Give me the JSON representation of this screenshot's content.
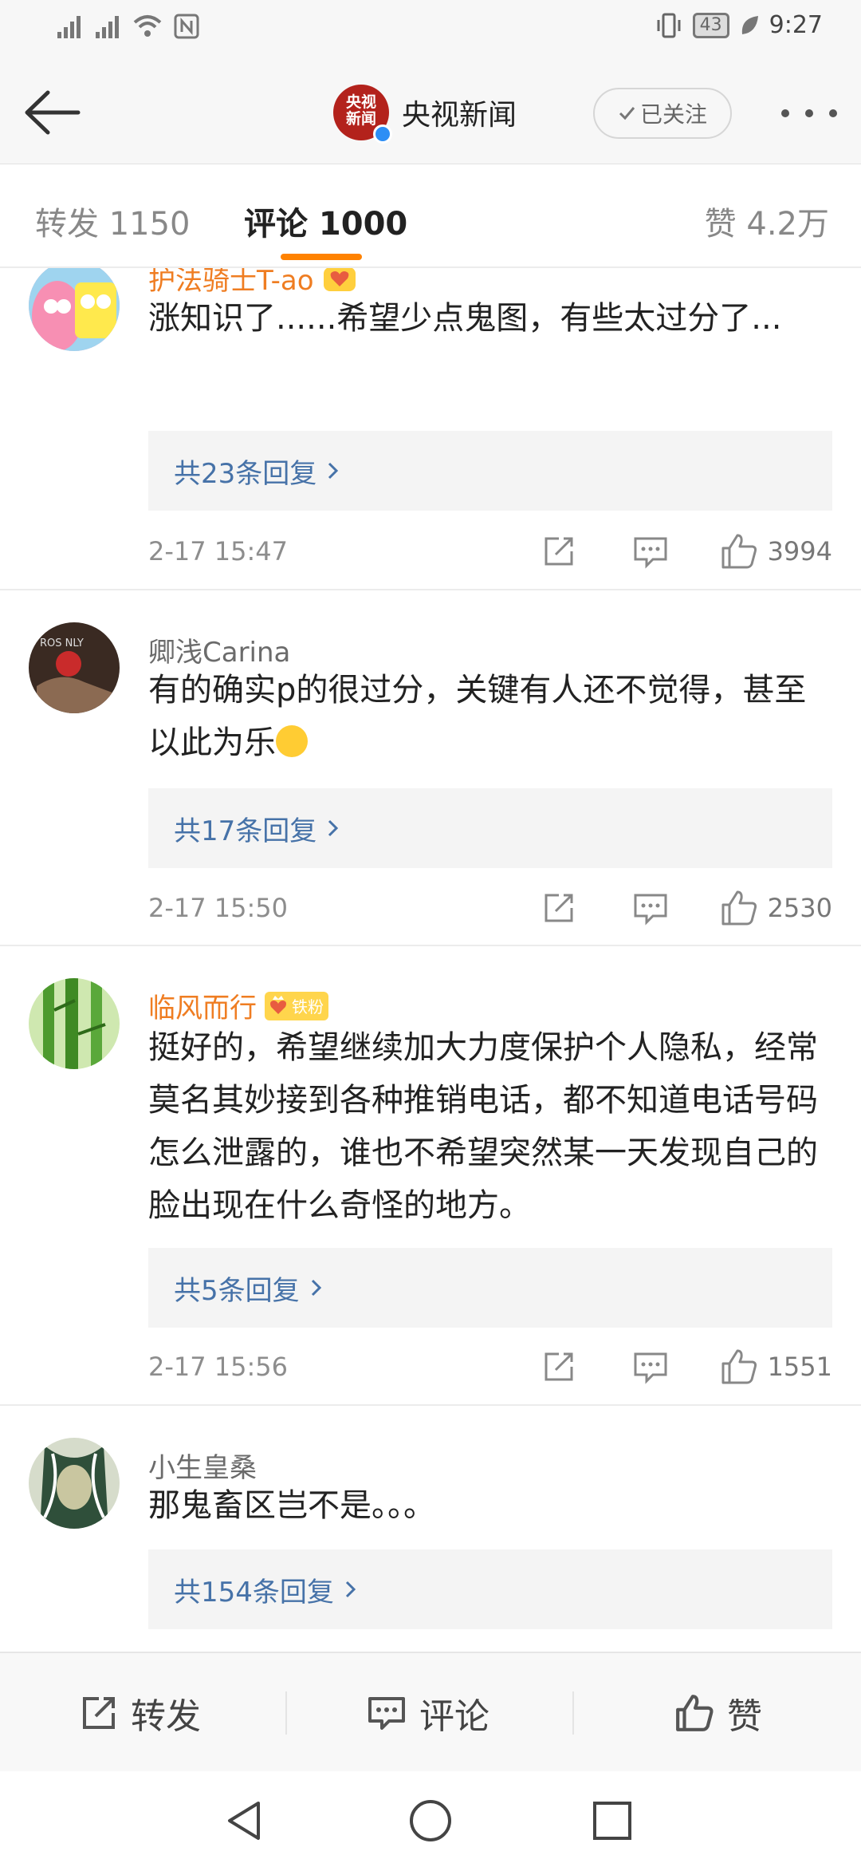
{
  "status_bar": {
    "battery": "43",
    "time": "9:27"
  },
  "header": {
    "account_avatar_text": "央视新闻",
    "account_name": "央视新闻",
    "follow_label": "已关注"
  },
  "tabs": {
    "repost": "转发 1150",
    "comment": "评论 1000",
    "like": "赞 4.2万",
    "accent_color": "#ff8200"
  },
  "comments": [
    {
      "user": "护法骑士T-ao",
      "text": "涨知识了......希望少点鬼图，有些太过分了...",
      "replies": "共23条回复",
      "time": "2-17 15:47",
      "likes": "3994"
    },
    {
      "user": "卿浅Carina",
      "text": "有的确实p的很过分，关键有人还不觉得，甚至以此为乐",
      "replies": "共17条回复",
      "time": "2-17 15:50",
      "likes": "2530"
    },
    {
      "user": "临风而行",
      "badge": "铁粉",
      "text": "挺好的，希望继续加大力度保护个人隐私，经常莫名其妙接到各种推销电话，都不知道电话号码怎么泄露的，谁也不希望突然某一天发现自己的脸出现在什么奇怪的地方。",
      "replies": "共5条回复",
      "time": "2-17 15:56",
      "likes": "1551"
    },
    {
      "user": "小生皇桑",
      "text": "那鬼畜区岂不是。。。",
      "replies": "共154条回复"
    }
  ],
  "bottom_bar": {
    "repost": "转发",
    "comment": "评论",
    "like": "赞"
  },
  "colors": {
    "username_orange": "#ef7d22",
    "reply_link_blue": "#4672a8"
  }
}
